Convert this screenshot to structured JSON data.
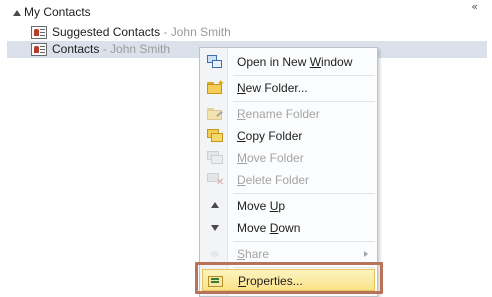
{
  "nav_pane": {
    "group_title": "My Contacts",
    "folders": [
      {
        "name": "Suggested Contacts",
        "separator": " - ",
        "owner": "John Smith"
      },
      {
        "name": "Contacts",
        "separator": " - ",
        "owner": "John Smith"
      }
    ]
  },
  "context_menu": {
    "items": [
      {
        "label": "Open in New Window",
        "mnemonic": "W"
      },
      {
        "label": "New Folder...",
        "mnemonic": "N"
      },
      {
        "label": "Rename Folder",
        "mnemonic": "R"
      },
      {
        "label": "Copy Folder",
        "mnemonic": "C"
      },
      {
        "label": "Move Folder",
        "mnemonic": "M"
      },
      {
        "label": "Delete Folder",
        "mnemonic": "D"
      },
      {
        "label": "Move Up",
        "mnemonic": "U"
      },
      {
        "label": "Move Down",
        "mnemonic": "D"
      },
      {
        "label": "Share",
        "mnemonic": "S"
      },
      {
        "label": "Properties...",
        "mnemonic": "P"
      }
    ]
  },
  "colors": {
    "selected_row": "#dbe1ea",
    "highlight": "#fbe38a",
    "annotation": "#b8735a",
    "disabled_text": "#a4a4a4"
  }
}
